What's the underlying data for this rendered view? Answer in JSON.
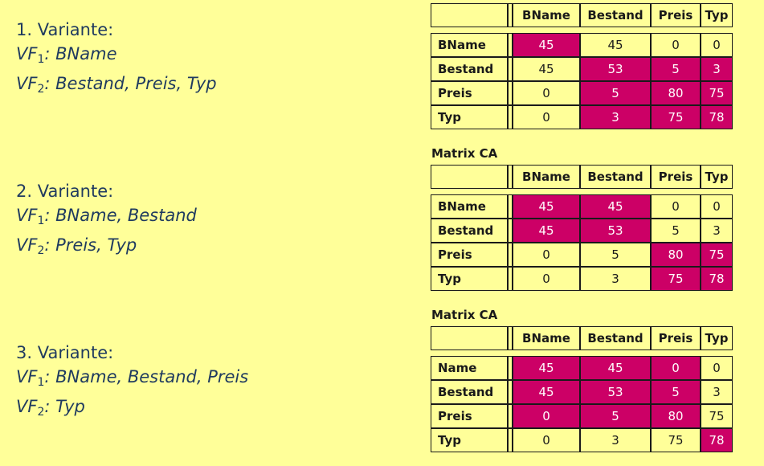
{
  "columns": [
    "BName",
    "Bestand",
    "Preis",
    "Typ"
  ],
  "caption": "Matrix CA",
  "variants": [
    {
      "title": "1. Variante:",
      "vf1_label": "VF",
      "vf1_sub": "1",
      "vf1_value": ": BName",
      "vf2_label": "VF",
      "vf2_sub": "2",
      "vf2_value": ": Bestand, Preis, Typ"
    },
    {
      "title": "2. Variante:",
      "vf1_label": "VF",
      "vf1_sub": "1",
      "vf1_value": ": BName, Bestand",
      "vf2_label": "VF",
      "vf2_sub": "2",
      "vf2_value": ": Preis, Typ"
    },
    {
      "title": "3. Variante:",
      "vf1_label": "VF",
      "vf1_sub": "1",
      "vf1_value": ": BName, Bestand, Preis",
      "vf2_label": "VF",
      "vf2_sub": "2",
      "vf2_value": ": Typ"
    }
  ],
  "matrices": [
    {
      "rows": [
        {
          "label": "BName",
          "values": [
            "45",
            "45",
            "0",
            "0"
          ]
        },
        {
          "label": "Bestand",
          "values": [
            "45",
            "53",
            "5",
            "3"
          ]
        },
        {
          "label": "Preis",
          "values": [
            "0",
            "5",
            "80",
            "75"
          ]
        },
        {
          "label": "Typ",
          "values": [
            "0",
            "3",
            "75",
            "78"
          ]
        }
      ],
      "highlight": [
        [
          1,
          0,
          0,
          0
        ],
        [
          0,
          1,
          1,
          1
        ],
        [
          0,
          1,
          1,
          1
        ],
        [
          0,
          1,
          1,
          1
        ]
      ]
    },
    {
      "rows": [
        {
          "label": "BName",
          "values": [
            "45",
            "45",
            "0",
            "0"
          ]
        },
        {
          "label": "Bestand",
          "values": [
            "45",
            "53",
            "5",
            "3"
          ]
        },
        {
          "label": "Preis",
          "values": [
            "0",
            "5",
            "80",
            "75"
          ]
        },
        {
          "label": "Typ",
          "values": [
            "0",
            "3",
            "75",
            "78"
          ]
        }
      ],
      "highlight": [
        [
          1,
          1,
          0,
          0
        ],
        [
          1,
          1,
          0,
          0
        ],
        [
          0,
          0,
          1,
          1
        ],
        [
          0,
          0,
          1,
          1
        ]
      ]
    },
    {
      "rows": [
        {
          "label": "Name",
          "values": [
            "45",
            "45",
            "0",
            "0"
          ]
        },
        {
          "label": "Bestand",
          "values": [
            "45",
            "53",
            "5",
            "3"
          ]
        },
        {
          "label": "Preis",
          "values": [
            "0",
            "5",
            "80",
            "75"
          ]
        },
        {
          "label": "Typ",
          "values": [
            "0",
            "3",
            "75",
            "78"
          ]
        }
      ],
      "highlight": [
        [
          1,
          1,
          1,
          0
        ],
        [
          1,
          1,
          1,
          0
        ],
        [
          1,
          1,
          1,
          0
        ],
        [
          0,
          0,
          0,
          1
        ]
      ]
    }
  ],
  "colors": {
    "background": "#ffff99",
    "highlight": "#cc0066",
    "text_left": "#1f3a5f"
  }
}
